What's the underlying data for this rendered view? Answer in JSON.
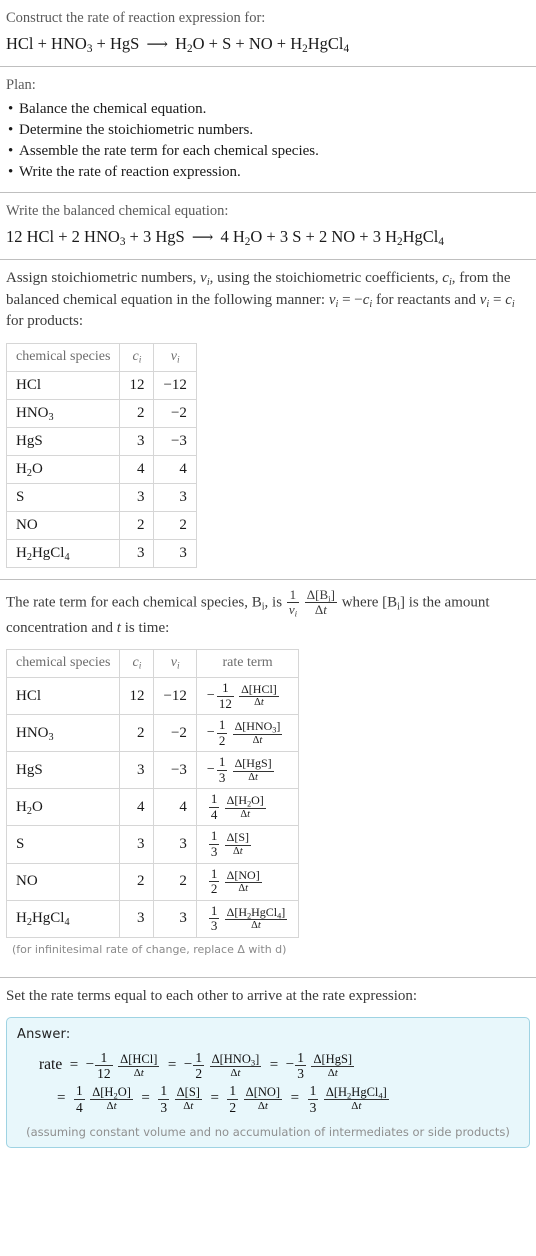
{
  "header": {
    "prompt": "Construct the rate of reaction expression for:",
    "equation_plain": "HCl + HNO3 + HgS ⟶ H2O + S + NO + H2HgCl4"
  },
  "plan": {
    "label": "Plan:",
    "items": [
      "Balance the chemical equation.",
      "Determine the stoichiometric numbers.",
      "Assemble the rate term for each chemical species.",
      "Write the rate of reaction expression."
    ]
  },
  "balanced": {
    "label": "Write the balanced chemical equation:",
    "equation_plain": "12 HCl + 2 HNO3 + 3 HgS ⟶ 4 H2O + 3 S + 2 NO + 3 H2HgCl4"
  },
  "assign": {
    "paragraph_line1": "Assign stoichiometric numbers, ν_i, using the stoichiometric coefficients, c_i, from",
    "paragraph_line2": "the balanced chemical equation in the following manner: ν_i = −c_i for reactants",
    "paragraph_line3": "and ν_i = c_i for products:"
  },
  "table1": {
    "headers": [
      "chemical species",
      "c_i",
      "ν_i"
    ],
    "rows": [
      {
        "species": "HCl",
        "c": "12",
        "v": "−12"
      },
      {
        "species": "HNO3",
        "c": "2",
        "v": "−2"
      },
      {
        "species": "HgS",
        "c": "3",
        "v": "−3"
      },
      {
        "species": "H2O",
        "c": "4",
        "v": "4"
      },
      {
        "species": "S",
        "c": "3",
        "v": "3"
      },
      {
        "species": "NO",
        "c": "2",
        "v": "2"
      },
      {
        "species": "H2HgCl4",
        "c": "3",
        "v": "3"
      }
    ]
  },
  "rateterm": {
    "paragraph_line1": "The rate term for each chemical species, B_i, is  1/ν_i · Δ[B_i]/Δt  where [B_i] is the amount",
    "paragraph_line2": "concentration and t is time:"
  },
  "table2": {
    "headers": [
      "chemical species",
      "c_i",
      "ν_i",
      "rate term"
    ],
    "rows": [
      {
        "species": "HCl",
        "c": "12",
        "v": "−12",
        "sign": "−",
        "denom": "12",
        "delta_num": "Δ[HCl]",
        "delta_den": "Δt"
      },
      {
        "species": "HNO3",
        "c": "2",
        "v": "−2",
        "sign": "−",
        "denom": "2",
        "delta_num": "Δ[HNO3]",
        "delta_den": "Δt"
      },
      {
        "species": "HgS",
        "c": "3",
        "v": "−3",
        "sign": "−",
        "denom": "3",
        "delta_num": "Δ[HgS]",
        "delta_den": "Δt"
      },
      {
        "species": "H2O",
        "c": "4",
        "v": "4",
        "sign": "",
        "denom": "4",
        "delta_num": "Δ[H2O]",
        "delta_den": "Δt"
      },
      {
        "species": "S",
        "c": "3",
        "v": "3",
        "sign": "",
        "denom": "3",
        "delta_num": "Δ[S]",
        "delta_den": "Δt"
      },
      {
        "species": "NO",
        "c": "2",
        "v": "2",
        "sign": "",
        "denom": "2",
        "delta_num": "Δ[NO]",
        "delta_den": "Δt"
      },
      {
        "species": "H2HgCl4",
        "c": "3",
        "v": "3",
        "sign": "",
        "denom": "3",
        "delta_num": "Δ[H2HgCl4]",
        "delta_den": "Δt"
      }
    ],
    "footnote": "(for infinitesimal rate of change, replace Δ with d)"
  },
  "final": {
    "label": "Set the rate terms equal to each other to arrive at the rate expression:",
    "answer_label": "Answer:",
    "expression_plain": "rate = −(1/12)Δ[HCl]/Δt = −(1/2)Δ[HNO3]/Δt = −(1/3)Δ[HgS]/Δt = (1/4)Δ[H2O]/Δt = (1/3)Δ[S]/Δt = (1/2)Δ[NO]/Δt = (1/3)Δ[H2HgCl4]/Δt",
    "rate_word": "rate",
    "assumption": "(assuming constant volume and no accumulation of intermediates or side products)"
  },
  "colors": {
    "answer_bg": "#e8f7fb",
    "answer_border": "#9fd3e3",
    "rule": "#bfbfbf",
    "table_border": "#d6d6d6",
    "muted_text": "#6d6d6d"
  }
}
